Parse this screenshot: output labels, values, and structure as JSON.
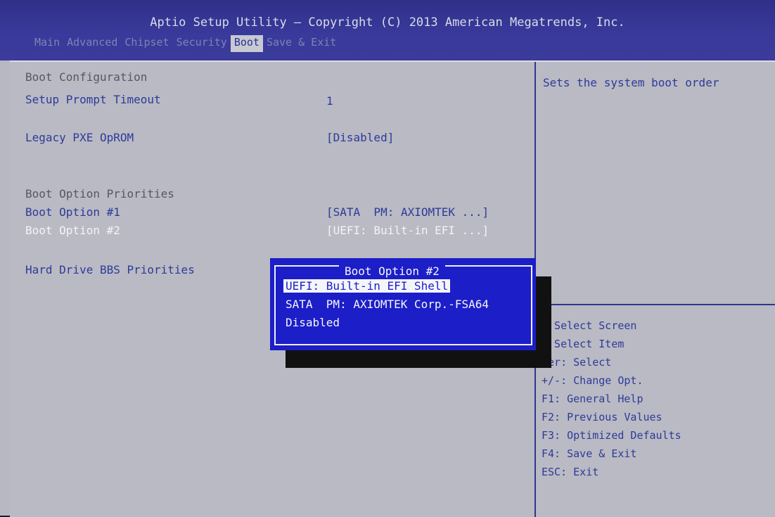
{
  "header": {
    "title": "Aptio Setup Utility – Copyright (C) 2013 American Megatrends, Inc.",
    "tabs": [
      "Main",
      "Advanced",
      "Chipset",
      "Security",
      "Boot",
      "Save & Exit"
    ],
    "active_tab": "Boot"
  },
  "settings": {
    "boot_configuration": "Boot Configuration",
    "setup_prompt_timeout": {
      "label": "Setup Prompt Timeout",
      "value": "1"
    },
    "legacy_pxe_oprom": {
      "label": "Legacy PXE OpROM",
      "value": "[Disabled]"
    },
    "boot_option_priorities": "Boot Option Priorities",
    "boot_option_1": {
      "label": "Boot Option #1",
      "value": "[SATA  PM: AXIOMTEK ...]"
    },
    "boot_option_2": {
      "label": "Boot Option #2",
      "value": "[UEFI: Built-in EFI ...]"
    },
    "hard_drive_bbs": "Hard Drive BBS Priorities"
  },
  "help": {
    "description": "Sets the system boot order",
    "keys": [
      ": Select Screen",
      ": Select Item",
      "ter: Select",
      "+/-: Change Opt.",
      "F1: General Help",
      "F2: Previous Values",
      "F3: Optimized Defaults",
      "F4: Save & Exit",
      "ESC: Exit"
    ]
  },
  "popup": {
    "title": "Boot Option #2",
    "options": [
      "UEFI: Built-in EFI Shell",
      "SATA  PM: AXIOMTEK Corp.-FSA64",
      "Disabled"
    ],
    "selected_index": 0
  },
  "colors": {
    "header_bg": "#3a3a9c",
    "screen_bg": "#b9bac3",
    "text_blue": "#2e3a9a",
    "popup_bg": "#1c1ec8"
  }
}
